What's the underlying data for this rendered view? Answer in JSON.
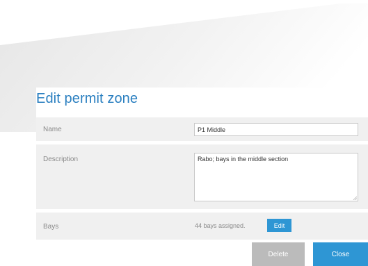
{
  "dialog": {
    "title": "Edit permit zone",
    "name": {
      "label": "Name",
      "value": "P1 Middle"
    },
    "description": {
      "label": "Description",
      "value": "Rabo; bays in the middle section"
    },
    "bays": {
      "label": "Bays",
      "status": "44 bays assigned.",
      "edit_label": "Edit"
    },
    "buttons": {
      "delete_label": "Delete",
      "close_label": "Close"
    }
  },
  "colors": {
    "accent": "#2e96d4",
    "title": "#2a7fc0",
    "row_background": "#f0f0f0",
    "disabled_button": "#bbbbbb"
  }
}
